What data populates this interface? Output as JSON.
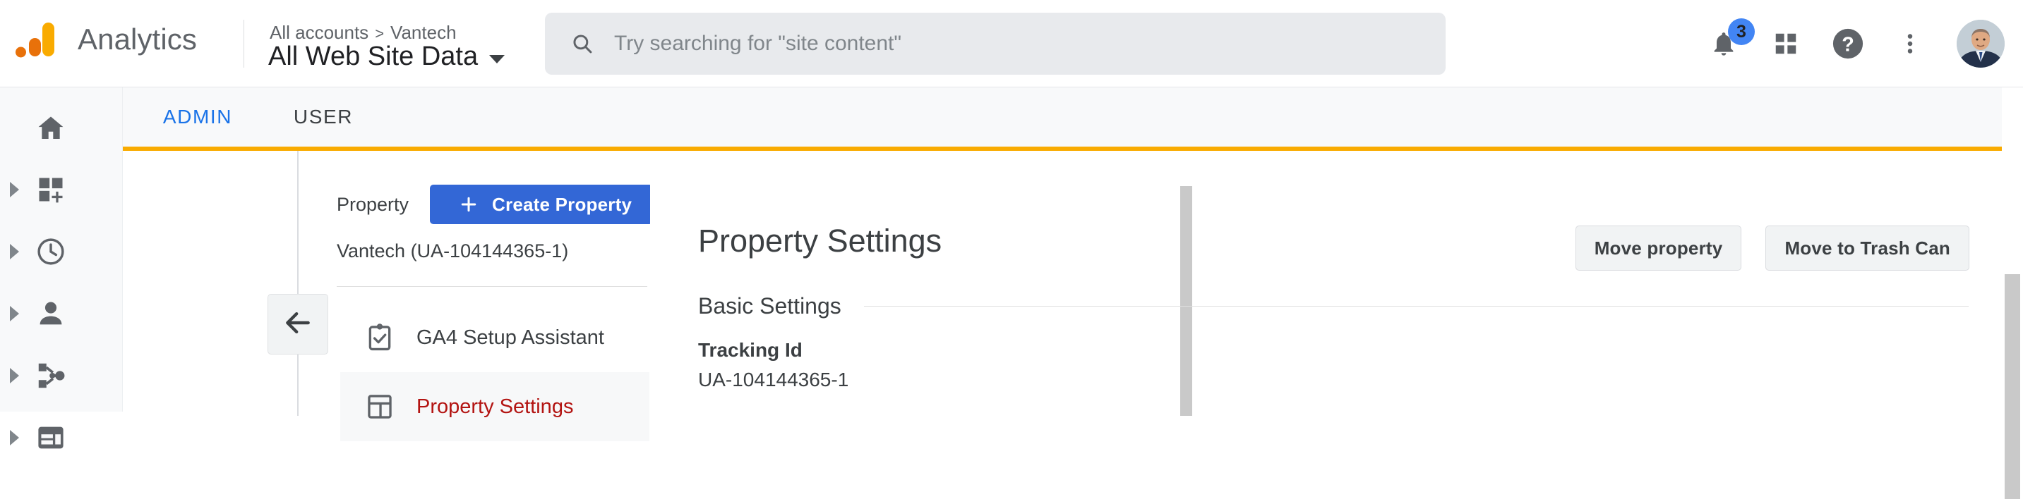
{
  "brand": {
    "logo_icon": "analytics-bars-logo",
    "logo_colors": [
      "#e8710a",
      "#f9ab00"
    ],
    "title": "Analytics"
  },
  "header": {
    "breadcrumb": {
      "root": "All accounts",
      "separator": ">",
      "account": "Vantech"
    },
    "view_name": "All Web Site Data",
    "view_caret_icon": "chevron-down-icon",
    "search": {
      "icon": "search-icon",
      "placeholder": "Try searching for \"site content\"",
      "value": ""
    },
    "icons": [
      {
        "name": "notifications-bell-icon",
        "badge": "3",
        "badge_color": "#4285f4"
      },
      {
        "name": "apps-grid-icon",
        "badge": ""
      },
      {
        "name": "help-circle-icon",
        "badge": ""
      },
      {
        "name": "more-vert-icon",
        "badge": ""
      }
    ],
    "avatar_label": "account-avatar"
  },
  "rail": {
    "items": [
      {
        "icon": "home-icon",
        "label": "Home",
        "expandable": false
      },
      {
        "icon": "customization-grid-plus-icon",
        "label": "Customization",
        "expandable": true
      },
      {
        "icon": "realtime-clock-icon",
        "label": "Realtime",
        "expandable": true
      },
      {
        "icon": "audience-person-icon",
        "label": "Audience",
        "expandable": true
      },
      {
        "icon": "acquisition-share-icon",
        "label": "Acquisition",
        "expandable": true
      },
      {
        "icon": "behavior-layout-icon",
        "label": "Behavior",
        "expandable": true
      }
    ]
  },
  "tabs": {
    "items": [
      {
        "label": "ADMIN",
        "active": true
      },
      {
        "label": "USER",
        "active": false
      }
    ],
    "active_color": "#1a73e8",
    "indicator_color": "#f9ab00"
  },
  "collapse_button": {
    "icon": "arrow-left-icon",
    "label": "Collapse panel"
  },
  "property_panel": {
    "column_label": "Property",
    "create_button": {
      "label": "Create Property",
      "icon": "plus-icon",
      "color": "#3367d6"
    },
    "property_name": "Vantech (UA-104144365-1)",
    "items": [
      {
        "icon": "clipboard-check-icon",
        "label": "GA4 Setup Assistant",
        "active": false
      },
      {
        "icon": "property-settings-layout-icon",
        "label": "Property Settings",
        "active": true
      }
    ],
    "active_color": "#b31412"
  },
  "main": {
    "page_title": "Property Settings",
    "actions": [
      {
        "label": "Move property"
      },
      {
        "label": "Move to Trash Can"
      }
    ],
    "section": {
      "title": "Basic Settings"
    },
    "fields": [
      {
        "label": "Tracking Id",
        "value": "UA-104144365-1"
      }
    ]
  },
  "scrollbars": {
    "page_thumb_color": "#c9c9c9",
    "inner_thumb_color": "#c9c9c9"
  }
}
